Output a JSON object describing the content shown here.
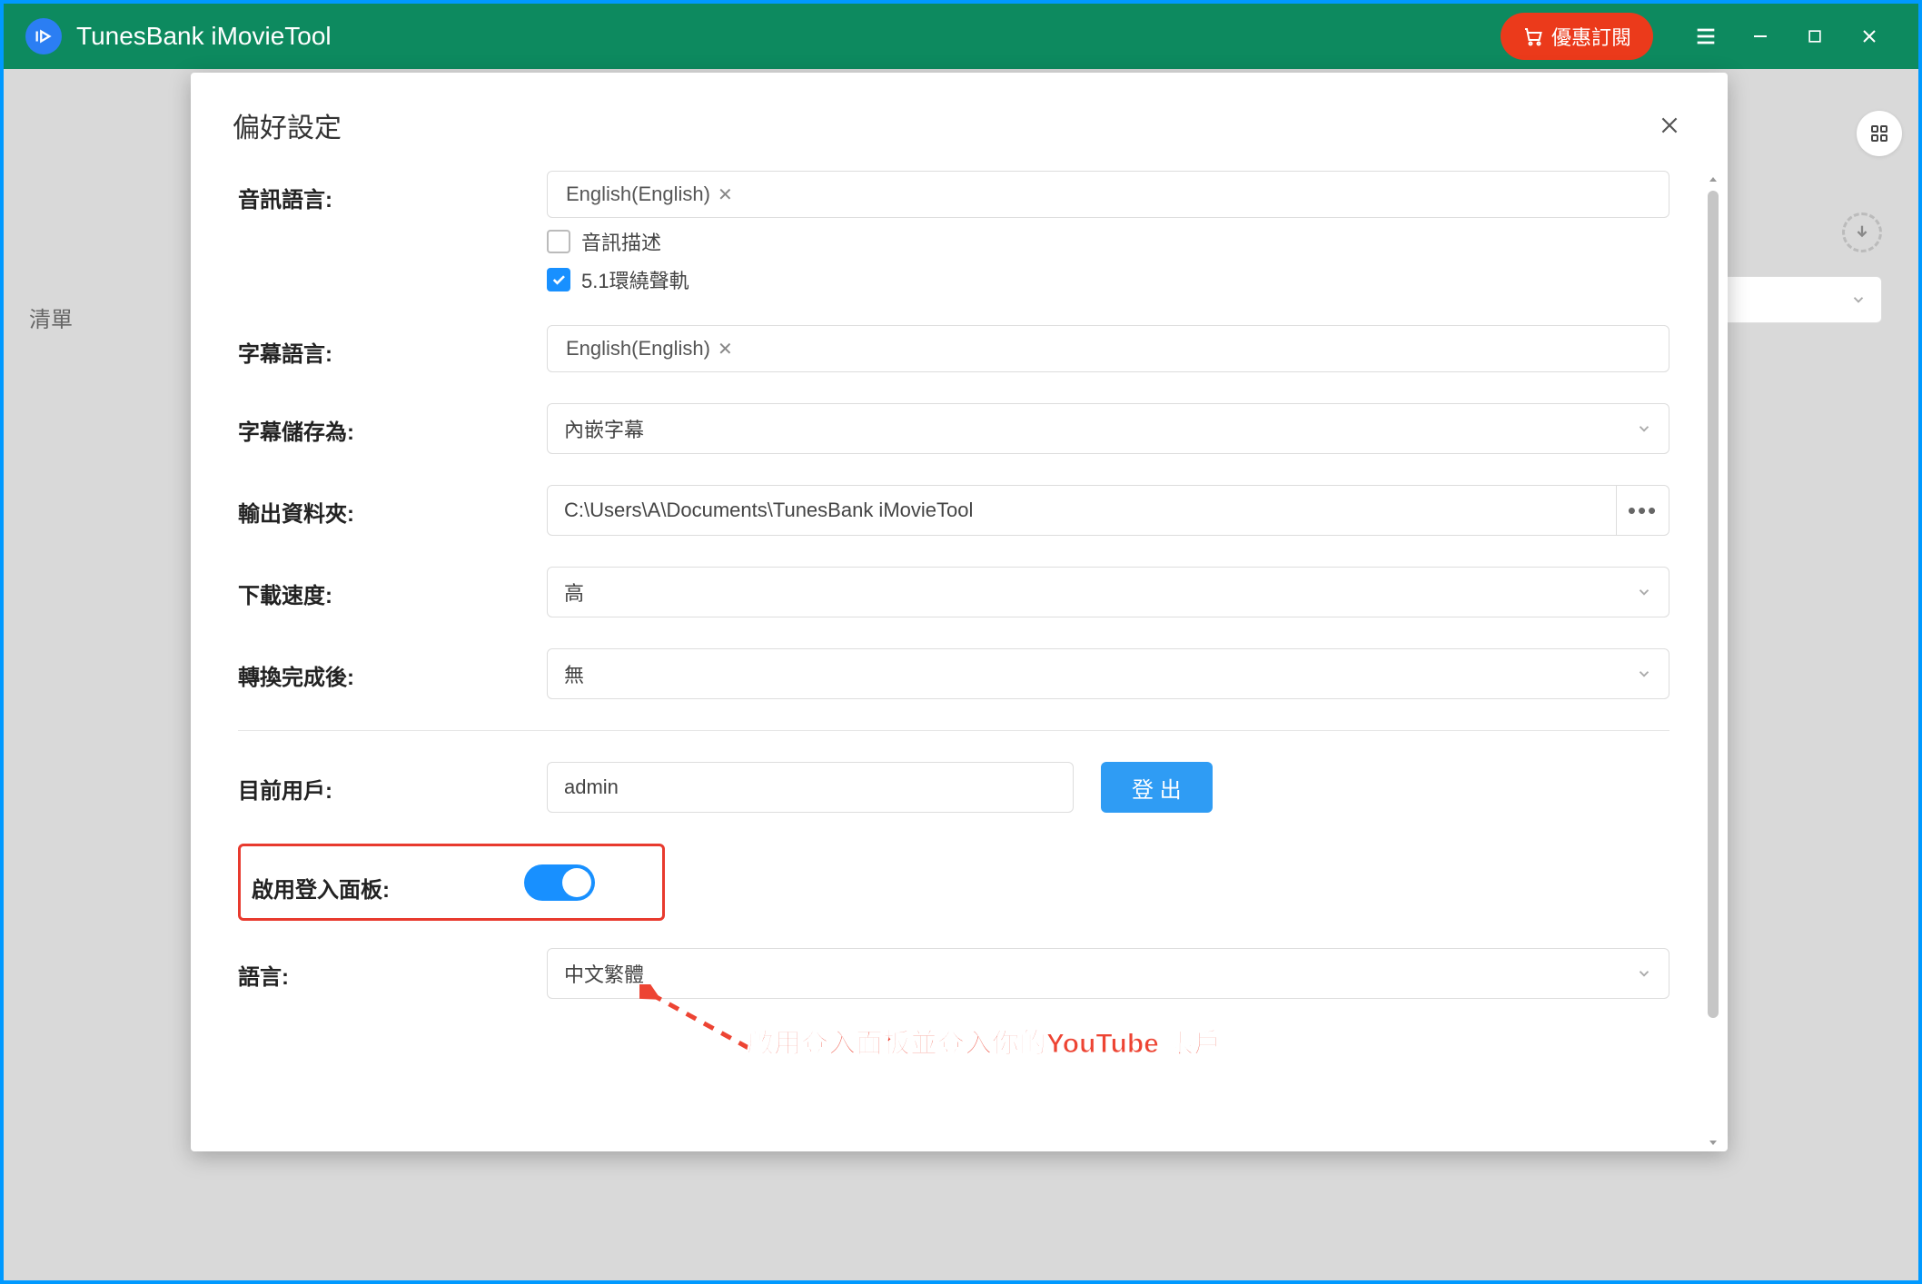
{
  "titlebar": {
    "app_name": "TunesBank iMovieTool",
    "subscribe_label": "優惠訂閱"
  },
  "background": {
    "list_label": "清單"
  },
  "modal": {
    "title": "偏好設定",
    "labels": {
      "audio_language": "音訊語言:",
      "subtitle_language": "字幕語言:",
      "subtitle_save_as": "字幕儲存為:",
      "output_folder": "輸出資料夾:",
      "download_speed": "下載速度:",
      "after_convert": "轉換完成後:",
      "current_user": "目前用戶:",
      "enable_login_panel": "啟用登入面板:",
      "language": "語言:"
    },
    "values": {
      "audio_language_tag": "English(English)",
      "audio_description_label": "音訊描述",
      "surround_label": "5.1環繞聲軌",
      "subtitle_language_tag": "English(English)",
      "subtitle_save_as": "內嵌字幕",
      "output_folder": "C:\\Users\\A\\Documents\\TunesBank iMovieTool",
      "download_speed": "高",
      "after_convert": "無",
      "current_user": "admin",
      "logout_label": "登 出",
      "language": "中文繁體"
    },
    "checkboxes": {
      "audio_description_checked": false,
      "surround_checked": true
    },
    "toggle": {
      "enable_login_panel": true
    }
  },
  "annotation": {
    "text": "啟用登入面板並登入你的YouTube 帳戶"
  }
}
